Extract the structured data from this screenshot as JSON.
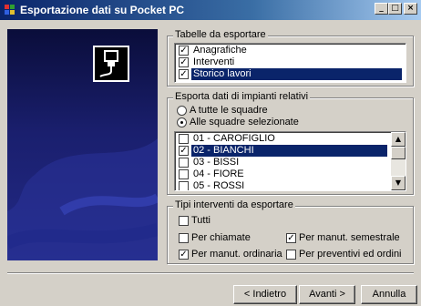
{
  "window": {
    "title": "Esportazione dati su Pocket PC",
    "minimize_glyph": "_",
    "maximize_glyph": "□",
    "close_glyph": "×"
  },
  "tables_group": {
    "title": "Tabelle da esportare",
    "items": [
      {
        "label": "Anagrafiche",
        "checked": true,
        "selected": false
      },
      {
        "label": "Interventi",
        "checked": true,
        "selected": false
      },
      {
        "label": "Storico lavori",
        "checked": true,
        "selected": true
      }
    ]
  },
  "plants_group": {
    "title": "Esporta dati di impianti relativi",
    "options": [
      {
        "label": "A tutte le squadre",
        "selected": false
      },
      {
        "label": "Alle squadre selezionate",
        "selected": true
      }
    ],
    "teams": [
      {
        "label": "01 - CAROFIGLIO",
        "checked": false,
        "selected": false
      },
      {
        "label": "02 - BIANCHI",
        "checked": true,
        "selected": true
      },
      {
        "label": "03 - BISSI",
        "checked": false,
        "selected": false
      },
      {
        "label": "04 - FIORE",
        "checked": false,
        "selected": false
      },
      {
        "label": "05 - ROSSI",
        "checked": false,
        "selected": false
      }
    ]
  },
  "intervention_group": {
    "title": "Tipi interventi da esportare",
    "tutti": {
      "label": "Tutti",
      "checked": false
    },
    "per_chiamate": {
      "label": "Per chiamate",
      "checked": false
    },
    "per_semestrale": {
      "label": "Per manut. semestrale",
      "checked": true
    },
    "per_ordinaria": {
      "label": "Per manut. ordinaria",
      "checked": true
    },
    "per_preventivi": {
      "label": "Per preventivi ed ordini",
      "checked": false
    }
  },
  "buttons": {
    "back": "< Indietro",
    "next": "Avanti >",
    "cancel": "Annulla"
  },
  "icons": {
    "app": "app-icon",
    "pocket_pc": "pocket-pc-connector-icon"
  }
}
